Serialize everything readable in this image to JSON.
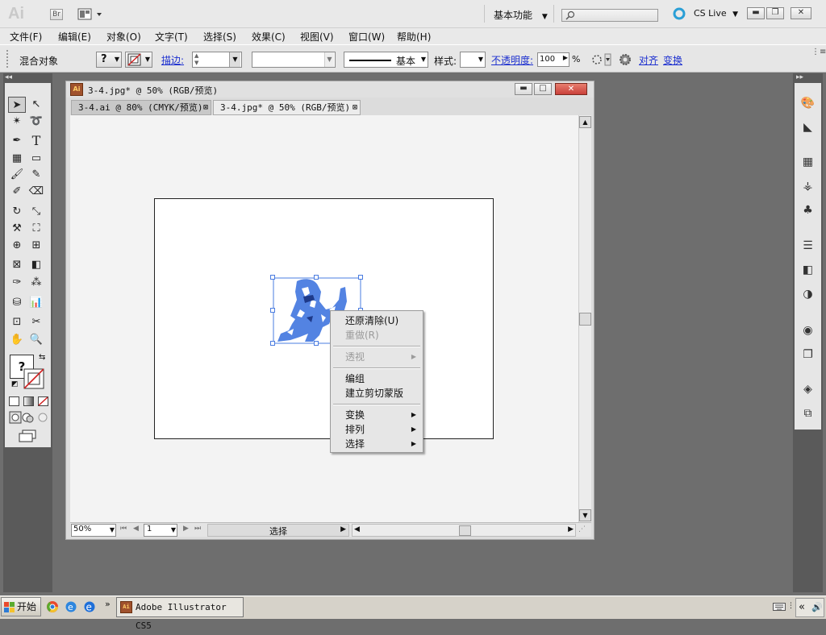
{
  "app": {
    "logo": "Ai",
    "bridge_button": "Br",
    "workspace": "基本功能",
    "cs_live": "CS Live"
  },
  "menubar": {
    "items": [
      "文件(F)",
      "编辑(E)",
      "对象(O)",
      "文字(T)",
      "选择(S)",
      "效果(C)",
      "视图(V)",
      "窗口(W)",
      "帮助(H)"
    ]
  },
  "control_bar": {
    "selection_label": "混合对象",
    "fill_value": "?",
    "stroke_label": "描边:",
    "stroke_profile": "基本",
    "style_label": "样式:",
    "opacity_label": "不透明度:",
    "opacity_value": "100",
    "opacity_unit": "%",
    "align_label": "对齐",
    "transform_label": "变换"
  },
  "document": {
    "window_title": "3-4.jpg* @ 50% (RGB/预览)",
    "tabs": [
      {
        "label": "3-4.ai @ 80% (CMYK/预览)",
        "active": false
      },
      {
        "label": "3-4.jpg* @ 50% (RGB/预览)",
        "active": true
      }
    ],
    "zoom": "50%",
    "page": "1",
    "status_text": "选择"
  },
  "tools": {
    "fill_swatch": "?"
  },
  "context_menu": {
    "items": [
      {
        "label": "还原清除(U)",
        "enabled": true,
        "submenu": false
      },
      {
        "label": "重做(R)",
        "enabled": false,
        "submenu": false
      },
      {
        "label": "透视",
        "enabled": false,
        "submenu": true
      },
      {
        "label": "编组",
        "enabled": true,
        "submenu": false
      },
      {
        "label": "建立剪切蒙版",
        "enabled": true,
        "submenu": false
      },
      {
        "label": "变换",
        "enabled": true,
        "submenu": true
      },
      {
        "label": "排列",
        "enabled": true,
        "submenu": true
      },
      {
        "label": "选择",
        "enabled": true,
        "submenu": true
      }
    ]
  },
  "taskbar": {
    "start_label": "开始",
    "task_item": "Adobe Illustrator CS5"
  },
  "colors": {
    "selection_blue": "#4a7ce0",
    "link_blue": "#1c2fcf",
    "close_red": "#c9403a"
  }
}
